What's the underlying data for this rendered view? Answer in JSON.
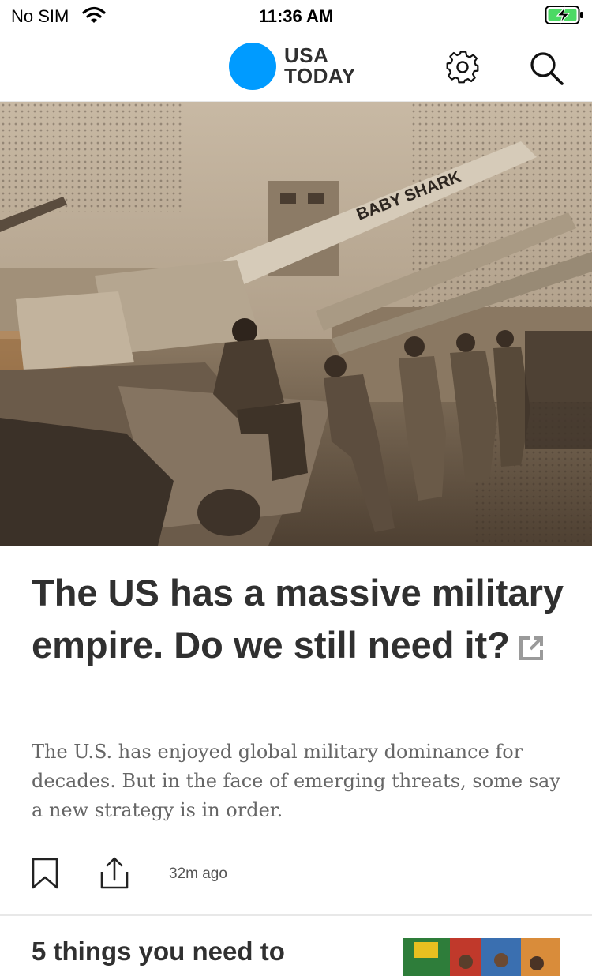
{
  "status_bar": {
    "carrier": "No SIM",
    "time": "11:36 AM",
    "battery": "charging"
  },
  "header": {
    "logo_line1": "USA",
    "logo_line2": "TODAY",
    "logo_color": "#009bff",
    "icons": [
      "gear-icon",
      "search-icon"
    ]
  },
  "hero": {
    "gun_marking": "BABY SHARK"
  },
  "article": {
    "headline": "The US has a massive military empire. Do we still need it?",
    "summary": "The U.S. has enjoyed global military dominance for decades. But in the face of emerging threats, some say a new strategy is in order.",
    "timestamp": "32m ago",
    "icons": [
      "bookmark-icon",
      "share-icon",
      "external-link-icon"
    ]
  },
  "next_article": {
    "title": "5 things you need to"
  }
}
